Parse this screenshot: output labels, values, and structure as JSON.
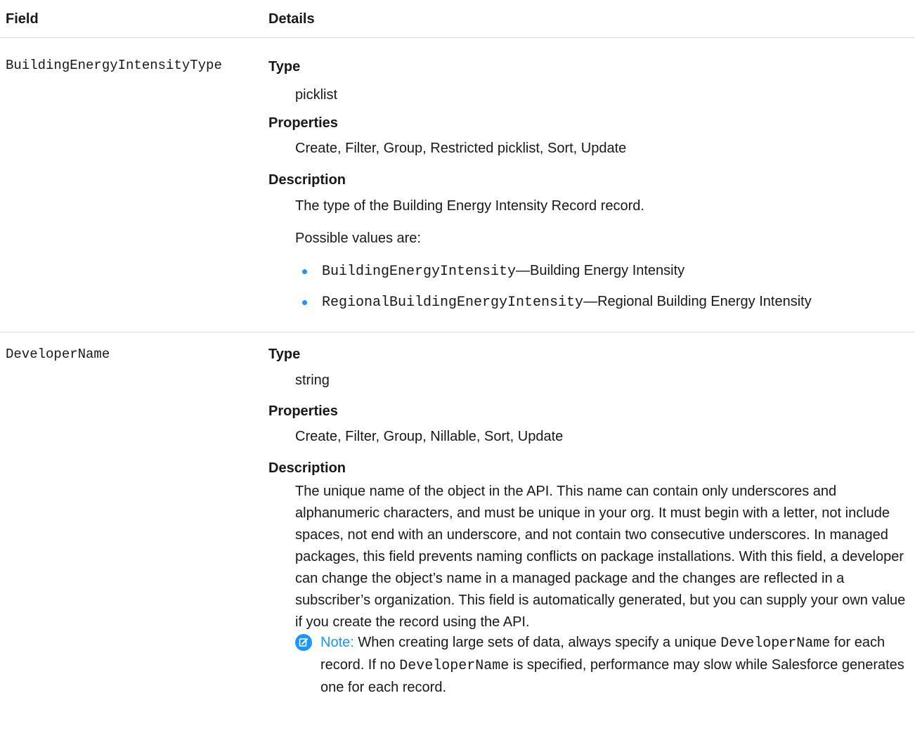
{
  "header": {
    "field": "Field",
    "details": "Details"
  },
  "rows": [
    {
      "field": "BuildingEnergyIntensityType",
      "type_label": "Type",
      "type_value": "picklist",
      "properties_label": "Properties",
      "properties_value": "Create, Filter, Group, Restricted picklist, Sort, Update",
      "description_label": "Description",
      "description_text": "The type of the Building Energy Intensity Record record.",
      "possible_values_intro": "Possible values are:",
      "values": [
        {
          "code": "BuildingEnergyIntensity",
          "label": "—Building Energy Intensity"
        },
        {
          "code": "RegionalBuildingEnergyIntensity",
          "label": "—Regional Building Energy Intensity"
        }
      ]
    },
    {
      "field": "DeveloperName",
      "type_label": "Type",
      "type_value": "string",
      "properties_label": "Properties",
      "properties_value": "Create, Filter, Group, Nillable, Sort, Update",
      "description_label": "Description",
      "description_text": "The unique name of the object in the API. This name can contain only underscores and alphanumeric characters, and must be unique in your org. It must begin with a letter, not include spaces, not end with an underscore, and not contain two consecutive underscores. In managed packages, this field prevents naming conflicts on package installations. With this field, a developer can change the object’s name in a managed package and the changes are reflected in a subscriber’s organization. This field is automatically generated, but you can supply your own value if you create the record using the API.",
      "note": {
        "label": "Note:",
        "text_1": " When creating large sets of data, always specify a unique ",
        "code_1": "DeveloperName",
        "text_2": " for each record. If no ",
        "code_2": "DeveloperName",
        "text_3": " is specified, performance may slow while Salesforce generates one for each record."
      }
    }
  ],
  "colors": {
    "accent": "#1b96ff",
    "text": "#181818",
    "divider": "#d6d6d6"
  },
  "icons": {
    "bullet": "bullet-dot-icon",
    "note": "note-edit-icon"
  }
}
